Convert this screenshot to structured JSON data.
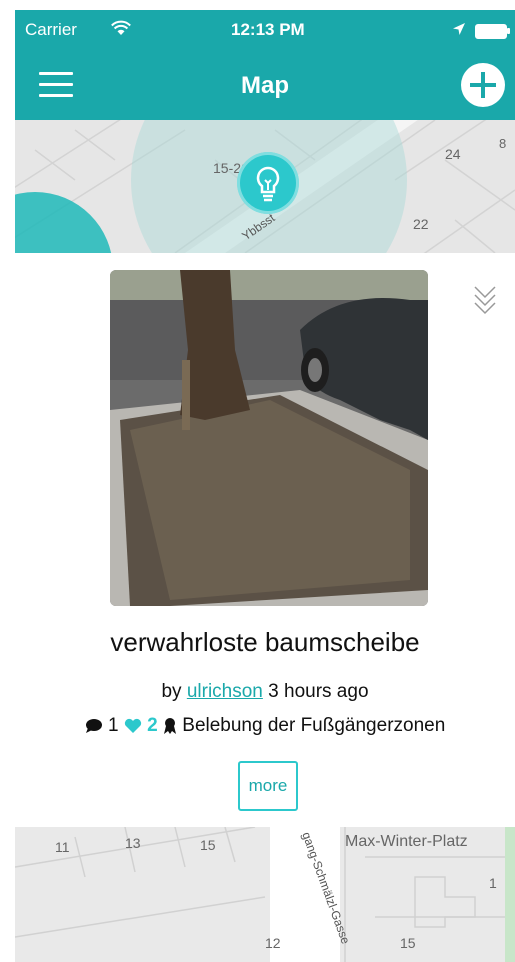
{
  "status_bar": {
    "carrier": "Carrier",
    "time": "12:13 PM"
  },
  "nav": {
    "title": "Map"
  },
  "map_top": {
    "labels": [
      "15-21",
      "24",
      "8",
      "22",
      "Ybbsst"
    ]
  },
  "post": {
    "title": "verwahrloste baumscheibe",
    "by_prefix": "by",
    "author": "ulrichson",
    "time_ago": "3 hours ago",
    "comments_count": "1",
    "likes_count": "2",
    "category": "Belebung der Fußgängerzonen",
    "more_label": "more"
  },
  "map_bottom": {
    "labels": [
      "11",
      "13",
      "15",
      "Max-Winter-Platz",
      "1",
      "12",
      "15",
      "gang-Schmälzl-Gasse"
    ]
  },
  "colors": {
    "accent": "#1aa8aa",
    "accent_light": "#2cc8cc"
  },
  "icons": [
    "wifi-icon",
    "location-arrow-icon",
    "battery-icon",
    "menu-icon",
    "plus-icon",
    "lightbulb-icon",
    "double-chevron-down-icon",
    "comment-icon",
    "heart-icon",
    "ribbon-icon"
  ]
}
